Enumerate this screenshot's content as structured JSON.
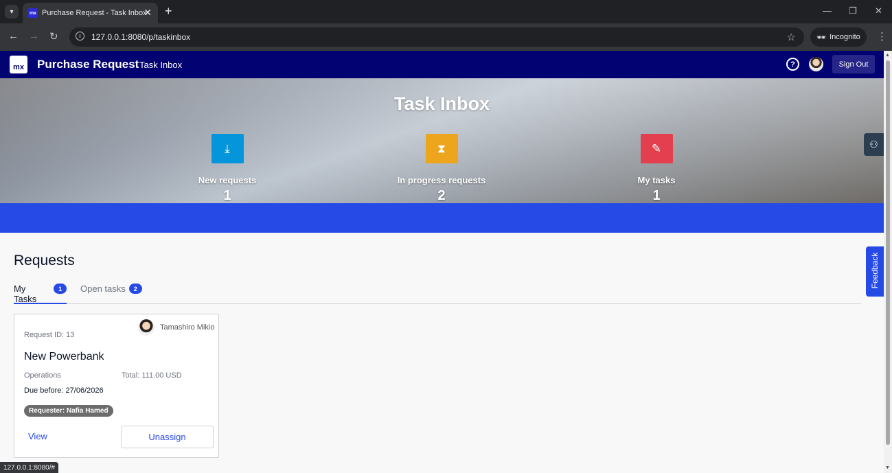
{
  "browser": {
    "tab_title": "Purchase Request - Task Inbox",
    "favicon_text": "mx",
    "url": "127.0.0.1:8080/p/taskinbox",
    "incognito_label": "Incognito",
    "status_url": "127.0.0.1:8080/#"
  },
  "appbar": {
    "logo_text": "mx",
    "app_title": "Purchase Request",
    "page_name": "Task Inbox",
    "help_symbol": "?",
    "signout_label": "Sign Out"
  },
  "hero": {
    "title": "Task Inbox",
    "stats": [
      {
        "label": "New requests",
        "value": "1",
        "icon": "download-icon",
        "color": "#0595DB"
      },
      {
        "label": "In progress requests",
        "value": "2",
        "icon": "hourglass-icon",
        "color": "#ECA51C"
      },
      {
        "label": "My tasks",
        "value": "1",
        "icon": "pin-icon",
        "color": "#E33F4E"
      }
    ]
  },
  "feedback_label": "Feedback",
  "requests": {
    "title": "Requests",
    "tabs": [
      {
        "label": "My Tasks",
        "count": "1",
        "active": true
      },
      {
        "label": "Open tasks",
        "count": "2",
        "active": false
      }
    ],
    "cards": [
      {
        "assignee": "Tamashiro Mikio",
        "request_id": "Request ID: 13",
        "title": "New Powerbank",
        "department": "Operations",
        "total": "Total: 111.00 USD",
        "due": "Due before: 27/06/2026",
        "requester": "Requester: Nafia Hamed",
        "view_label": "View",
        "unassign_label": "Unassign"
      }
    ]
  },
  "colors": {
    "appbar": "#020272",
    "accent": "#264AE5"
  }
}
